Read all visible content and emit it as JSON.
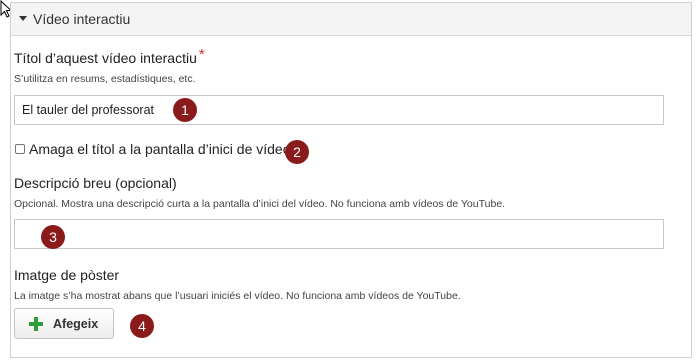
{
  "section": {
    "title": "Vídeo interactiu"
  },
  "title_field": {
    "label": "Títol d’aquest vídeo interactiu",
    "required_mark": "*",
    "description": "S’utilitza en resums, estadístiques, etc.",
    "value": "El tauler del professorat"
  },
  "hide_title": {
    "label": "Amaga el títol a la pantalla d’inici de vídeo",
    "checked": false
  },
  "short_description": {
    "label": "Descripció breu (opcional)",
    "description": "Opcional. Mostra una descripció curta a la pantalla d’inici del vídeo. No funciona amb vídeos de YouTube.",
    "value": ""
  },
  "poster": {
    "label": "Imatge de pòster",
    "description": "La imatge s’ha mostrat abans que l’usuari iniciés el vídeo. No funciona amb vídeos de YouTube.",
    "button_label": "Afegeix"
  },
  "callouts": [
    "1",
    "2",
    "3",
    "4"
  ],
  "colors": {
    "callout": "#8b1a1a",
    "required": "#c9302c",
    "add_icon": "#2e9e3a"
  },
  "icons": {
    "cursor": "arrow-cursor-icon",
    "section_toggle": "caret-down-icon",
    "add": "plus-icon"
  }
}
